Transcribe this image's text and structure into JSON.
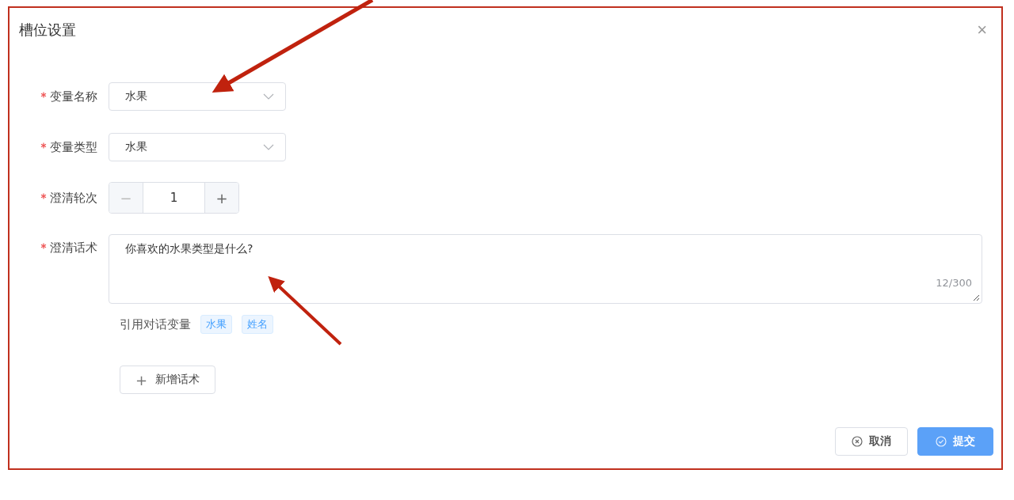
{
  "dialog": {
    "title": "槽位设置",
    "close": "×"
  },
  "fields": [
    {
      "kind": "select",
      "label": "变量名称",
      "required": true,
      "value": "水果"
    },
    {
      "kind": "select",
      "label": "变量类型",
      "required": true,
      "value": "水果"
    },
    {
      "kind": "number",
      "label": "澄清轮次",
      "required": true,
      "value": "1",
      "minus": "−",
      "plus": "+"
    },
    {
      "kind": "textarea",
      "label": "澄清话术",
      "required": true,
      "value": "你喜欢的水果类型是什么?",
      "count": "12/300"
    }
  ],
  "reference": {
    "label": "引用对话变量",
    "tags": [
      "水果",
      "姓名"
    ]
  },
  "add_button": {
    "icon": "+",
    "label": "新增话术"
  },
  "buttons": [
    {
      "kind": "default",
      "label": "取消"
    },
    {
      "kind": "primary",
      "label": "提交"
    }
  ]
}
